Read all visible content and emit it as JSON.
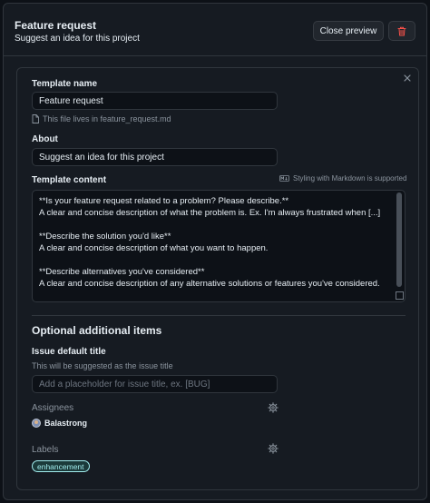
{
  "header": {
    "title": "Feature request",
    "subtitle": "Suggest an idea for this project",
    "close_preview_label": "Close preview"
  },
  "template": {
    "name_label": "Template name",
    "name_value": "Feature request",
    "file_hint": "This file lives in feature_request.md",
    "about_label": "About",
    "about_value": "Suggest an idea for this project",
    "content_label": "Template content",
    "markdown_note": "Styling with Markdown is supported",
    "content_lines": [
      "**Is your feature request related to a problem? Please describe.**",
      "A clear and concise description of what the problem is. Ex. I'm always frustrated when [...]",
      "",
      "**Describe the solution you'd like**",
      "A clear and concise description of what you want to happen.",
      "",
      "**Describe alternatives you've considered**",
      "A clear and concise description of any alternative solutions or features you've considered."
    ]
  },
  "optional": {
    "section_title": "Optional additional items",
    "issue_title_label": "Issue default title",
    "issue_title_hint": "This will be suggested as the issue title",
    "issue_title_placeholder": "Add a placeholder for issue title, ex. [BUG]",
    "assignees_label": "Assignees",
    "assignee_name": "Balastrong",
    "labels_label": "Labels",
    "label_badge": "enhancement"
  },
  "colors": {
    "background": "#161b22",
    "danger": "#f85149",
    "badge": "#a2eeef"
  },
  "icons": [
    "trash-icon",
    "close-icon",
    "file-icon",
    "markdown-icon",
    "gear-icon"
  ]
}
